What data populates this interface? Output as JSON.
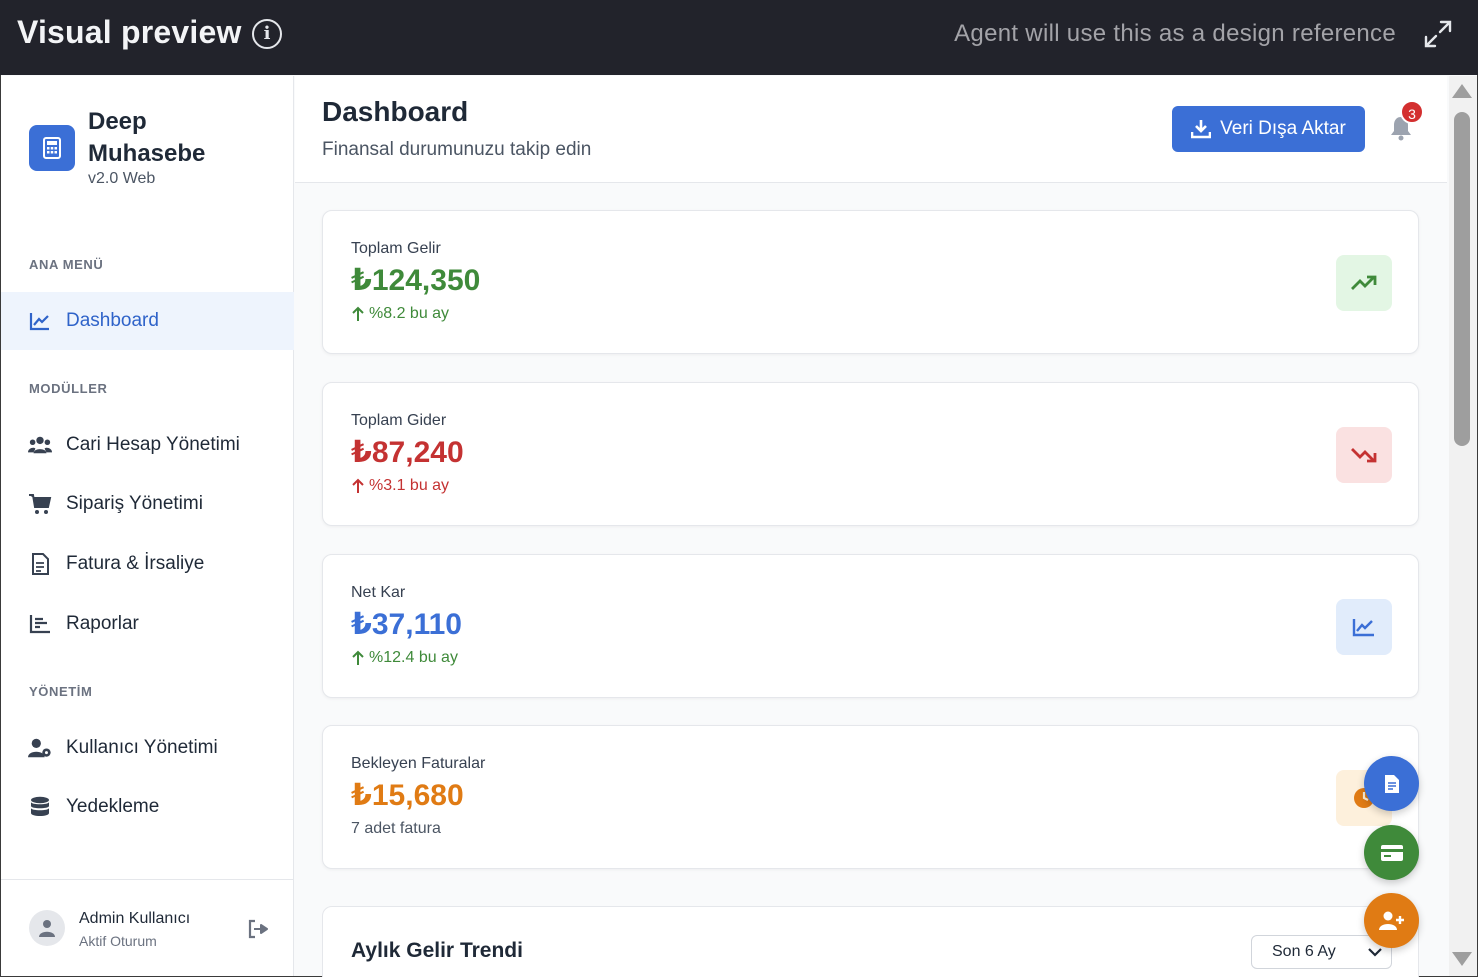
{
  "topbar": {
    "title": "Visual preview",
    "info_glyph": "i",
    "reference_text": "Agent will use this as a design reference"
  },
  "brand": {
    "name": "Deep Muhasebe",
    "version": "v2.0 Web"
  },
  "sidebar": {
    "sections": {
      "main": "ANA MENÜ",
      "modules": "MODÜLLER",
      "admin": "YÖNETİM"
    },
    "items": [
      {
        "label": "Dashboard",
        "icon": "chart-line-icon",
        "active": true
      },
      {
        "label": "Cari Hesap Yönetimi",
        "icon": "users-icon",
        "active": false
      },
      {
        "label": "Sipariş Yönetimi",
        "icon": "cart-icon",
        "active": false
      },
      {
        "label": "Fatura & İrsaliye",
        "icon": "document-icon",
        "active": false
      },
      {
        "label": "Raporlar",
        "icon": "bar-chart-icon",
        "active": false
      },
      {
        "label": "Kullanıcı Yönetimi",
        "icon": "user-cog-icon",
        "active": false
      },
      {
        "label": "Yedekleme",
        "icon": "database-icon",
        "active": false
      }
    ],
    "user": {
      "name": "Admin Kullanıcı",
      "status": "Aktif Oturum"
    }
  },
  "header": {
    "title": "Dashboard",
    "subtitle": "Finansal durumunuzu takip edin",
    "export_label": "Veri Dışa Aktar",
    "notification_count": "3"
  },
  "cards": [
    {
      "label": "Toplam Gelir",
      "value": "₺124,350",
      "change": "%8.2 bu ay",
      "color": "#3f8a3a",
      "icon": "trend-up-icon",
      "icon_bg": "#e3f6e4"
    },
    {
      "label": "Toplam Gider",
      "value": "₺87,240",
      "change": "%3.1 bu ay",
      "color": "#c43232",
      "icon": "trend-down-icon",
      "icon_bg": "#fae1e1"
    },
    {
      "label": "Net Kar",
      "value": "₺37,110",
      "change": "%12.4 bu ay",
      "color": "#3b6fd6",
      "icon": "chart-line-icon",
      "icon_bg": "#e1ecfb"
    },
    {
      "label": "Bekleyen Faturalar",
      "value": "₺15,680",
      "change": "7 adet fatura",
      "color": "#e07b14",
      "icon": "clock-icon",
      "icon_bg": "#fdf0dc"
    }
  ],
  "trend": {
    "title": "Aylık Gelir Trendi",
    "range_selected": "Son 6 Ay"
  },
  "colors": {
    "accent": "#3b6fd6",
    "success": "#3f8a3a",
    "danger": "#c43232",
    "warning": "#e07b14"
  }
}
